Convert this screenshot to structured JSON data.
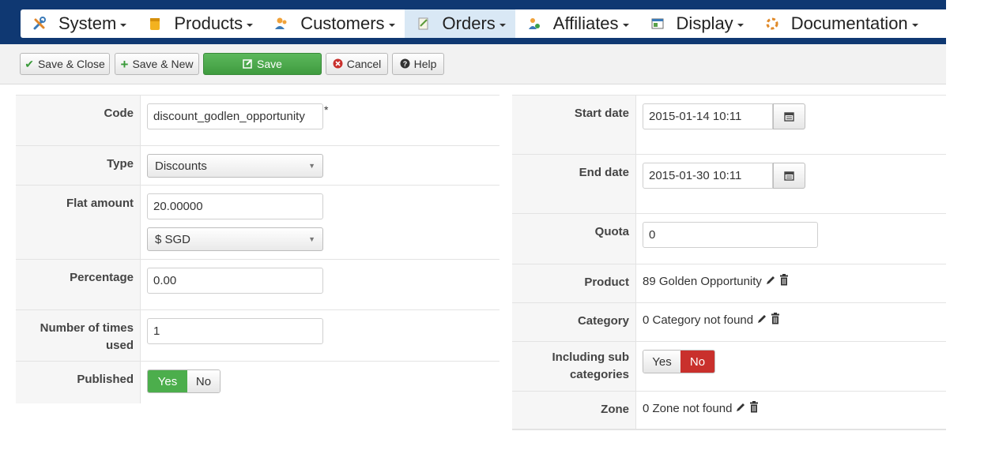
{
  "menu": [
    {
      "label": "System",
      "icon": "tools-icon"
    },
    {
      "label": "Products",
      "icon": "products-icon"
    },
    {
      "label": "Customers",
      "icon": "customers-icon"
    },
    {
      "label": "Orders",
      "icon": "orders-icon",
      "active": true
    },
    {
      "label": "Affiliates",
      "icon": "affiliates-icon"
    },
    {
      "label": "Display",
      "icon": "display-icon"
    },
    {
      "label": "Documentation",
      "icon": "documentation-icon"
    }
  ],
  "toolbar": {
    "save_close": "Save & Close",
    "save_new": "Save & New",
    "save": "Save",
    "cancel": "Cancel",
    "help": "Help"
  },
  "left_form": {
    "code_label": "Code",
    "code_value": "discount_godlen_opportunity",
    "required_mark": "*",
    "type_label": "Type",
    "type_value": "Discounts",
    "flat_label": "Flat amount",
    "flat_value": "20.00000",
    "currency_value": "$ SGD",
    "percentage_label": "Percentage",
    "percentage_value": "0.00",
    "times_used_label": "Number of times used",
    "times_used_value": "1",
    "published_label": "Published",
    "published_yes": "Yes",
    "published_no": "No"
  },
  "right_form": {
    "start_label": "Start date",
    "start_value": "2015-01-14 10:11",
    "end_label": "End date",
    "end_value": "2015-01-30 10:11",
    "quota_label": "Quota",
    "quota_value": "0",
    "product_label": "Product",
    "product_value": "89 Golden Opportunity",
    "category_label": "Category",
    "category_value": "0 Category not found",
    "subcat_label": "Including sub categories",
    "subcat_yes": "Yes",
    "subcat_no": "No",
    "zone_label": "Zone",
    "zone_value": "0 Zone not found"
  },
  "colors": {
    "nav": "#0f3872",
    "green": "#4cae4c",
    "red": "#c9302c",
    "active_menu": "#d9e8f5"
  }
}
